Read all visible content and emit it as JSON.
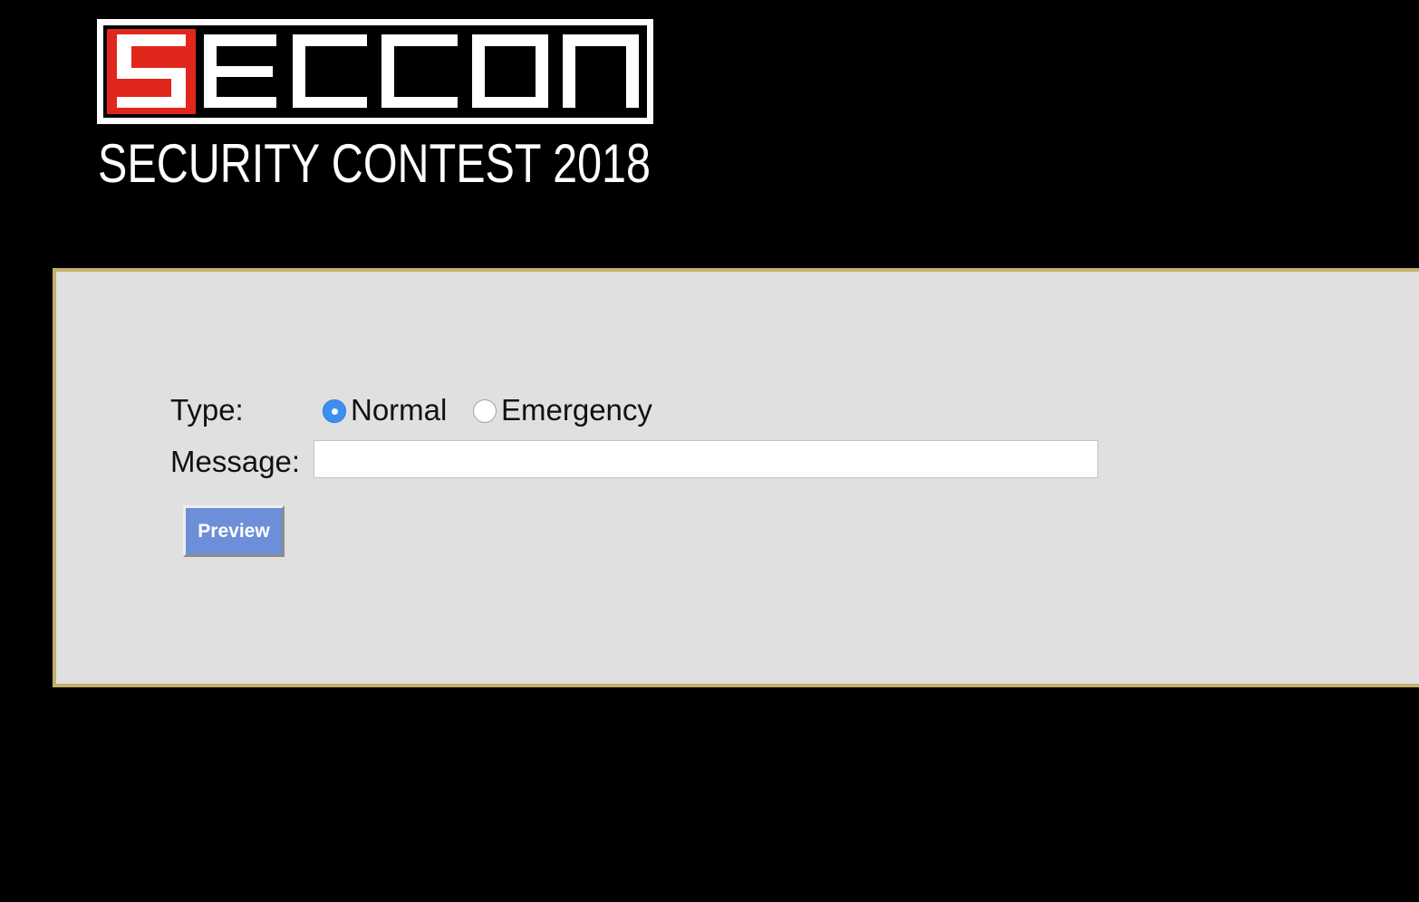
{
  "logo": {
    "wordmark": "SECCON",
    "tagline": "SECURITY CONTEST 2018",
    "colors": {
      "accent_red": "#e1261c",
      "white": "#ffffff",
      "background": "#000000"
    }
  },
  "form": {
    "type_label": "Type:",
    "type_options": [
      {
        "label": "Normal",
        "selected": true
      },
      {
        "label": "Emergency",
        "selected": false
      }
    ],
    "message_label": "Message:",
    "message_value": "",
    "message_placeholder": "",
    "preview_label": "Preview"
  },
  "colors": {
    "page_background": "#000000",
    "panel_background": "#e0e0e0",
    "panel_border": "#c2b06d",
    "button_background": "#6d8fd9",
    "radio_selected": "#3d8ef0"
  }
}
